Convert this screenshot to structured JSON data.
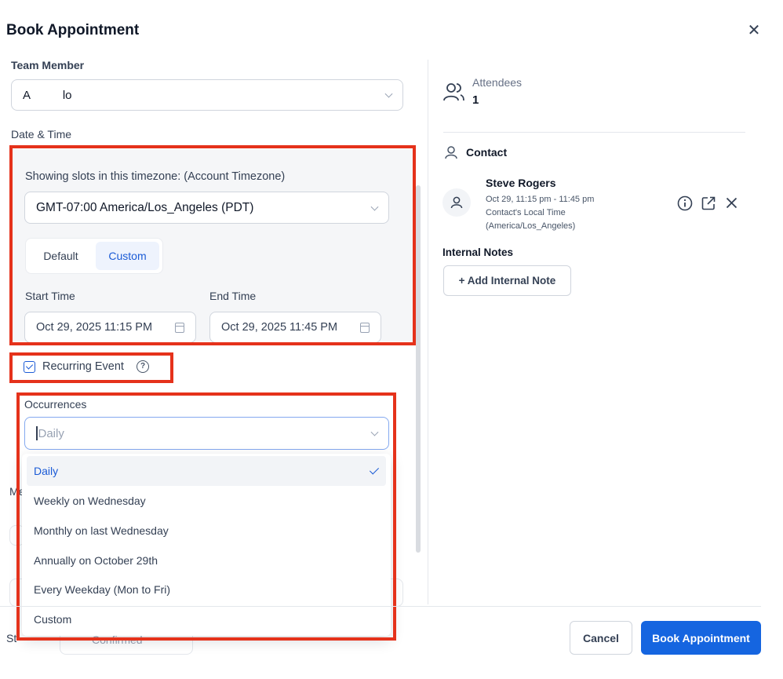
{
  "dialog": {
    "title": "Book Appointment",
    "close_icon": "close-icon"
  },
  "left": {
    "team_member_label": "Team Member",
    "team_member_value": "A          lo",
    "date_time_label": "Date & Time",
    "timezone_prompt": "Showing slots in this timezone: (Account Timezone)",
    "timezone_value": "GMT-07:00 America/Los_Angeles (PDT)",
    "segment": {
      "default_label": "Default",
      "custom_label": "Custom",
      "active": "Custom"
    },
    "start_time_label": "Start Time",
    "start_time_value": "Oct 29, 2025 11:15 PM",
    "end_time_label": "End Time",
    "end_time_value": "Oct 29, 2025 11:45 PM",
    "recurring_label": "Recurring Event",
    "recurring_checked": true,
    "occurrences_label": "Occurrences",
    "occurrences_placeholder": "Daily",
    "occurrences_options": [
      "Daily",
      "Weekly on Wednesday",
      "Monthly on last Wednesday",
      "Annually on October 29th",
      "Every Weekday (Mon to Fri)",
      "Custom"
    ],
    "occurrences_selected": "Daily",
    "obscured_label_fragment": "Me",
    "status_label_fragment": "St",
    "status_value_fragment": "Confirmed"
  },
  "right": {
    "attendees_label": "Attendees",
    "attendees_count": "1",
    "contact_heading": "Contact",
    "contact_name": "Steve Rogers",
    "contact_time": "Oct 29, 11:15 pm - 11:45 pm",
    "contact_local_time_label": "Contact's Local Time",
    "contact_timezone": "(America/Los_Angeles)",
    "internal_notes_label": "Internal Notes",
    "add_note_label": "+ Add Internal Note"
  },
  "footer": {
    "cancel_label": "Cancel",
    "book_label": "Book Appointment"
  },
  "colors": {
    "primary": "#1565e0",
    "highlight_border": "#e5321b",
    "selected_text": "#1b5bd6"
  }
}
